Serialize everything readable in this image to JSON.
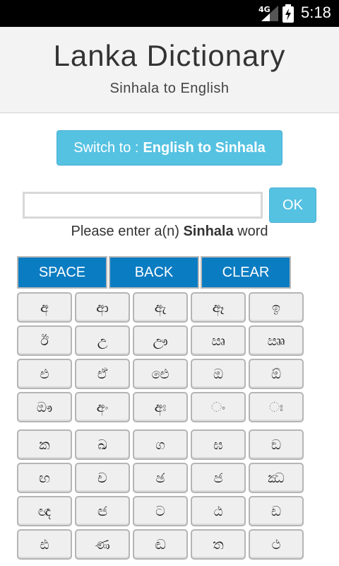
{
  "status_bar": {
    "network": "4G",
    "time": "5:18"
  },
  "header": {
    "title": "Lanka Dictionary",
    "subtitle": "Sinhala to English"
  },
  "switch": {
    "prefix": "Switch to : ",
    "target": "English to Sinhala"
  },
  "search": {
    "value": "",
    "ok_label": "OK"
  },
  "prompt": {
    "before": "Please enter a(n) ",
    "lang": "Sinhala",
    "after": " word"
  },
  "controls": {
    "space": "SPACE",
    "back": "BACK",
    "clear": "CLEAR"
  },
  "vowels": [
    "අ",
    "ආ",
    "ඇ",
    "ඈ",
    "ඉ",
    "ඊ",
    "උ",
    "ඌ",
    "ඍ",
    "ඎ",
    "එ",
    "ඒ",
    "ඓ",
    "ඔ",
    "ඕ",
    "ඖ",
    "අං",
    "අඃ",
    "ං",
    "ඃ"
  ],
  "consonants": [
    "ක",
    "ඛ",
    "ග",
    "ඝ",
    "ඞ",
    "ඟ",
    "ච",
    "ඡ",
    "ජ",
    "ඣ",
    "ඥ",
    "ඦ",
    "ට",
    "ඨ",
    "ඩ",
    "ඪ",
    "ණ",
    "ඬ",
    "ත",
    "ථ"
  ],
  "colors": {
    "accent": "#56c2e2",
    "control": "#0a7cc2"
  }
}
